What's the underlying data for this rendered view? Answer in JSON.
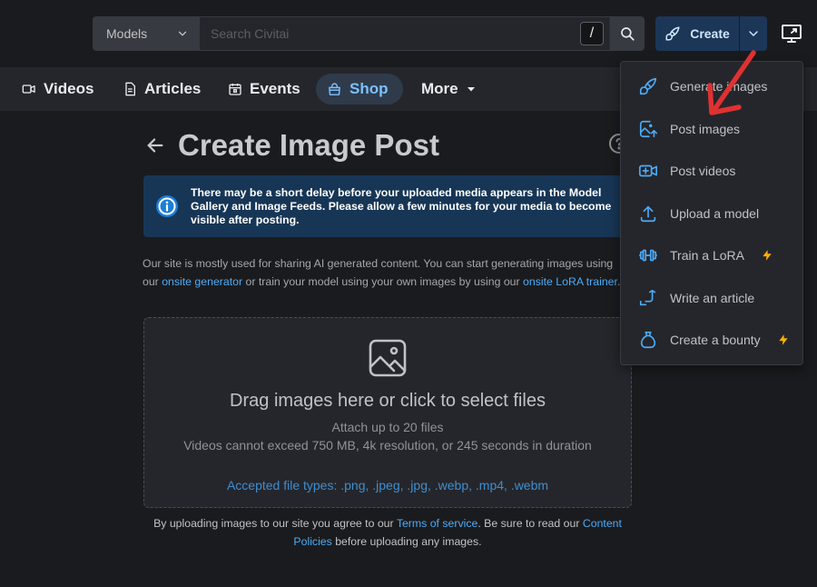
{
  "header": {
    "search_select": "Models",
    "search_placeholder": "Search Civitai",
    "search_shortcut": "/",
    "create_label": "Create"
  },
  "nav": {
    "items": [
      {
        "label": "Videos",
        "icon": "video-icon"
      },
      {
        "label": "Articles",
        "icon": "article-icon"
      },
      {
        "label": "Events",
        "icon": "calendar-icon"
      },
      {
        "label": "Shop",
        "icon": "shop-icon",
        "active": true
      },
      {
        "label": "More",
        "icon": "chevron-down-icon"
      }
    ]
  },
  "page": {
    "title": "Create Image Post",
    "alert": "There may be a short delay before your uploaded media appears in the Model Gallery and Image Feeds. Please allow a few minutes for your media to become visible after posting.",
    "intro_pre": "Our site is mostly used for sharing AI generated content. You can start generating images using our ",
    "intro_link1": "onsite generator",
    "intro_mid": " or train your model using your own images by using our ",
    "intro_link2": "onsite LoRA trainer",
    "intro_post": "."
  },
  "dropzone": {
    "title": "Drag images here or click to select files",
    "sub1": "Attach up to 20 files",
    "sub2": "Videos cannot exceed 750 MB, 4k resolution, or 245 seconds in duration",
    "types": "Accepted file types: .png, .jpeg, .jpg, .webp, .mp4, .webm"
  },
  "terms": {
    "pre": "By uploading images to our site you agree to our ",
    "link1": "Terms of service",
    "mid": ". Be sure to read our ",
    "link2": "Content Policies",
    "post": " before uploading any images."
  },
  "menu": {
    "items": [
      {
        "label": "Generate images",
        "icon": "brush-icon"
      },
      {
        "label": "Post images",
        "icon": "image-upload-icon"
      },
      {
        "label": "Post videos",
        "icon": "video-plus-icon"
      },
      {
        "label": "Upload a model",
        "icon": "upload-icon"
      },
      {
        "label": "Train a LoRA",
        "icon": "barbell-icon",
        "bolt": true
      },
      {
        "label": "Write an article",
        "icon": "pencil-icon"
      },
      {
        "label": "Create a bounty",
        "icon": "moneybag-icon",
        "bolt": true
      }
    ]
  },
  "colors": {
    "accent": "#4dabf7",
    "bolt": "#fab005",
    "annotation": "#e03131"
  }
}
